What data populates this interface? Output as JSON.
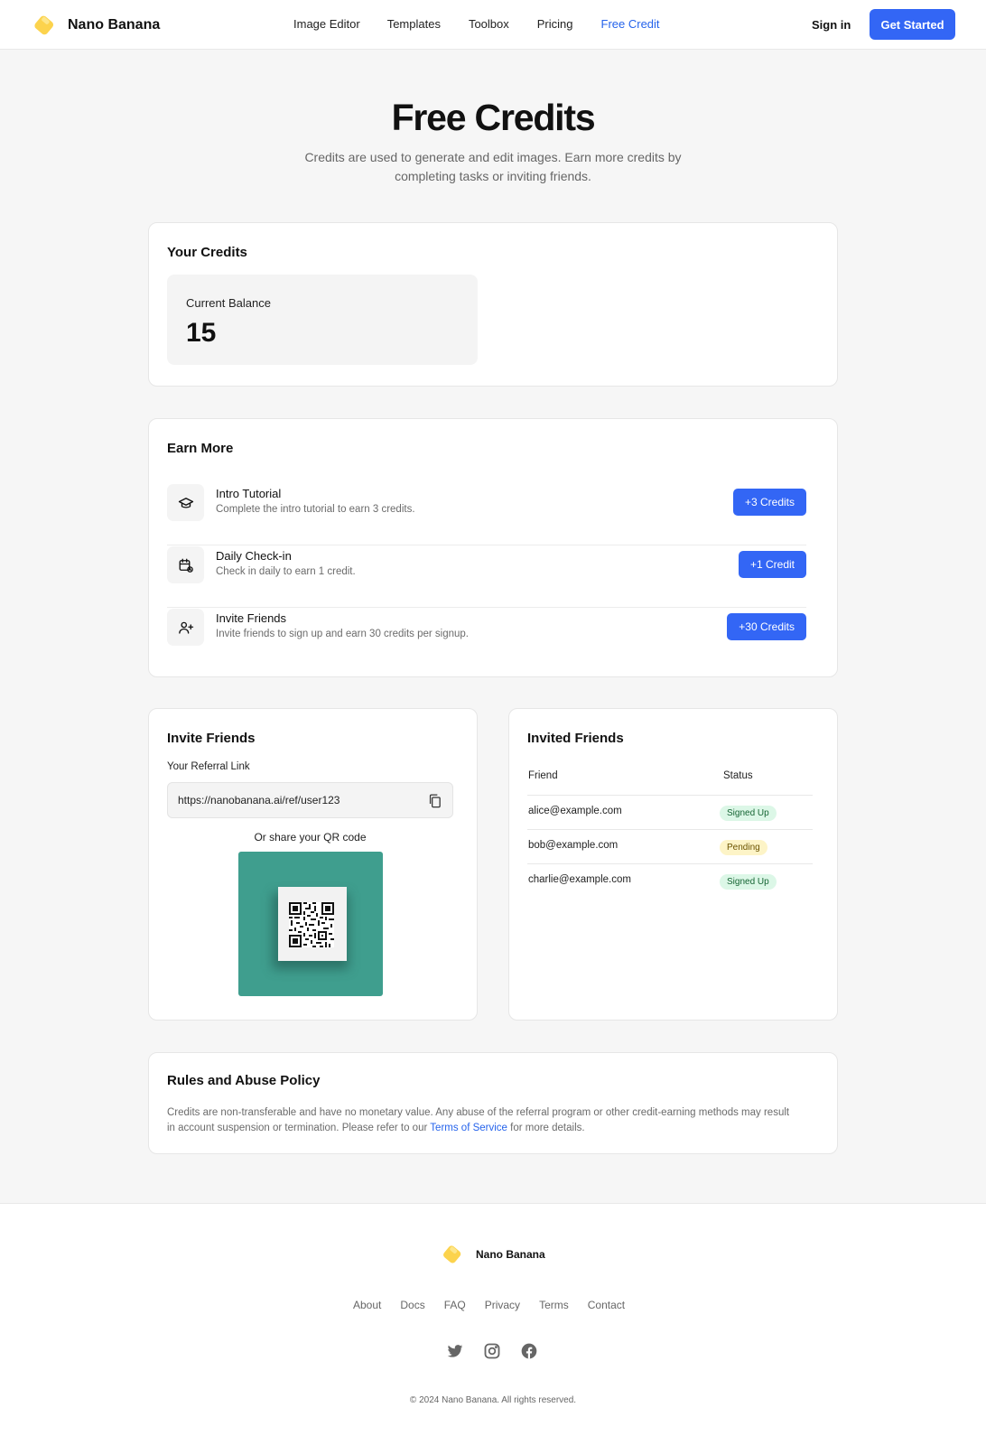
{
  "header": {
    "brand": "Nano Banana",
    "nav": [
      "Image Editor",
      "Templates",
      "Toolbox",
      "Pricing",
      "Free Credit"
    ],
    "sign_in": "Sign in",
    "get_started": "Get Started"
  },
  "hero": {
    "title": "Free Credits",
    "subtitle": "Credits are used to generate and edit images. Earn more credits by completing tasks or inviting friends."
  },
  "credits": {
    "title": "Your Credits",
    "balance_label": "Current Balance",
    "balance_value": "15"
  },
  "earn": {
    "title": "Earn More",
    "items": [
      {
        "icon": "graduation-cap-icon",
        "title": "Intro Tutorial",
        "desc": "Complete the intro tutorial to earn 3 credits.",
        "button": "+3 Credits"
      },
      {
        "icon": "calendar-check-icon",
        "title": "Daily Check-in",
        "desc": "Check in daily to earn 1 credit.",
        "button": "+1 Credit"
      },
      {
        "icon": "user-plus-icon",
        "title": "Invite Friends",
        "desc": "Invite friends to sign up and earn 30 credits per signup.",
        "button": "+30 Credits"
      }
    ]
  },
  "invite": {
    "title": "Invite Friends",
    "ref_label": "Your Referral Link",
    "ref_link": "https://nanobanana.ai/ref/user123",
    "qr_caption": "Or share your QR code"
  },
  "invited": {
    "title": "Invited Friends",
    "columns": [
      "Friend",
      "Status"
    ],
    "rows": [
      {
        "email": "alice@example.com",
        "status": "Signed Up",
        "tone": "green"
      },
      {
        "email": "bob@example.com",
        "status": "Pending",
        "tone": "yellow"
      },
      {
        "email": "charlie@example.com",
        "status": "Signed Up",
        "tone": "green"
      }
    ]
  },
  "rules": {
    "title": "Rules and Abuse Policy",
    "text_before": "Credits are non-transferable and have no monetary value. Any abuse of the referral program or other credit-earning methods may result in account suspension or termination. Please refer to our ",
    "link": "Terms of Service",
    "text_after": " for more details."
  },
  "footer": {
    "brand": "Nano Banana",
    "links": [
      "About",
      "Docs",
      "FAQ",
      "Privacy",
      "Terms",
      "Contact"
    ],
    "social": [
      "twitter-icon",
      "instagram-icon",
      "facebook-icon"
    ],
    "copyright": "© 2024 Nano Banana. All rights reserved."
  },
  "colors": {
    "accent": "#3366f5",
    "brand_yellow": "#fcd34d",
    "qr_background": "#3f9e8e"
  }
}
